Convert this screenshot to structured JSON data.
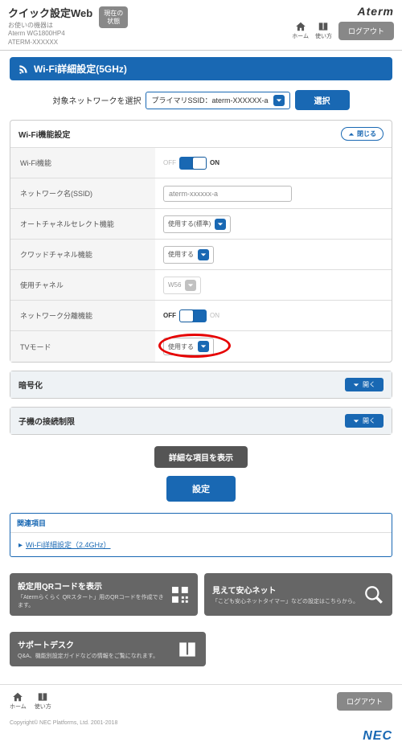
{
  "header": {
    "title": "クイック設定Web",
    "sub1": "お使いの機器は",
    "sub2": "Aterm WG1800HP4",
    "sub3": "ATERM-XXXXXX",
    "status": "現在の\n状態",
    "brand": "Aterm",
    "home": "ホーム",
    "help": "使い方",
    "logout": "ログアウト"
  },
  "section": {
    "title": "Wi-Fi詳細設定(5GHz)"
  },
  "selector": {
    "label": "対象ネットワークを選択",
    "value": "プライマリSSID：aterm-XXXXXX-a",
    "button": "選択"
  },
  "panel1": {
    "title": "Wi-Fi機能設定",
    "close": "閉じる",
    "rows": {
      "wifi": {
        "label": "Wi-Fi機能",
        "off": "OFF",
        "on": "ON"
      },
      "ssid": {
        "label": "ネットワーク名(SSID)",
        "value": "aterm-xxxxxx-a"
      },
      "auto": {
        "label": "オートチャネルセレクト機能",
        "value": "使用する(標準)"
      },
      "quad": {
        "label": "クワッドチャネル機能",
        "value": "使用する"
      },
      "chan": {
        "label": "使用チャネル",
        "value": "W56"
      },
      "sep": {
        "label": "ネットワーク分離機能",
        "off": "OFF",
        "on": "ON"
      },
      "tv": {
        "label": "TVモード",
        "value": "使用する"
      }
    }
  },
  "panel2": {
    "title": "暗号化",
    "open": "開く"
  },
  "panel3": {
    "title": "子機の接続制限",
    "open": "開く"
  },
  "actions": {
    "detail": "詳細な項目を表示",
    "set": "設定"
  },
  "related": {
    "head": "関連項目",
    "link": "Wi-Fi詳細設定（2.4GHz）"
  },
  "cards": {
    "qr": {
      "title": "設定用QRコードを表示",
      "sub": "「Atermらくらく QRスタート」用のQRコードを作成できます。"
    },
    "safe": {
      "title": "見えて安心ネット",
      "sub": "「こども安心ネットタイマー」などの設定はこちらから。"
    },
    "sup": {
      "title": "サポートデスク",
      "sub": "Q&A、機能別設定ガイドなどの情報をご覧になれます。"
    }
  },
  "footer": {
    "home": "ホーム",
    "help": "使い方",
    "logout": "ログアウト",
    "copyright": "Copyright© NEC Platforms, Ltd. 2001-2018",
    "nec": "NEC"
  }
}
